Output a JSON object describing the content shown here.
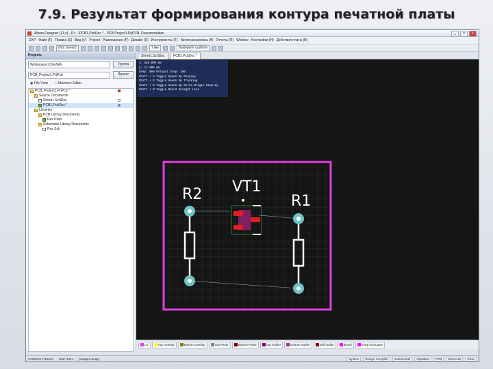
{
  "slide": {
    "title": "7.9. Результат формирования контура печатной платы"
  },
  "window": {
    "title": "Altium Designer (13.x) - D:\\...\\PCB1.PcbDoc * - PCB Project1.PrjPCB. Documentation",
    "controls": [
      "_",
      "□",
      "×"
    ]
  },
  "menu": [
    "DXP",
    "Файл (F)",
    "Правка (E)",
    "Вид (V)",
    "Project",
    "Размещение (P)",
    "Дизайн (D)",
    "Инструменты (T)",
    "Автотрассировка (A)",
    "Отчеты (R)",
    "Window",
    "Настройки (H)",
    "Действия платы (B)"
  ],
  "toolbar": {
    "combo1": "(Not Saved)",
    "combo2": "1 мм",
    "combo3": "Выберите шаблон"
  },
  "projects": {
    "header": "Projects",
    "workspace": "Workspace1.DsnWrk",
    "workspace_btn": "Группа",
    "project": "PCB_Project1.PrjPcb",
    "project_btn": "Проект",
    "view_file": "File View",
    "view_struct": "Structure Editor",
    "tree": [
      {
        "label": "PCB_Project1.PrjPcb *",
        "level": 0,
        "flag": "red"
      },
      {
        "label": "Source Documents",
        "level": 1,
        "flag": ""
      },
      {
        "label": "Sheet1.SchDoc",
        "level": 2,
        "flag": ""
      },
      {
        "label": "PCB1.PcbDoc *",
        "level": 2,
        "flag": "blue",
        "selected": true
      },
      {
        "label": "Libraries",
        "level": 1,
        "flag": ""
      },
      {
        "label": "PCB Library Documents",
        "level": 2,
        "flag": ""
      },
      {
        "label": "Res Pads",
        "level": 3,
        "flag": ""
      },
      {
        "label": "Schematic Library Documents",
        "level": 2,
        "flag": ""
      },
      {
        "label": "Res Sch",
        "level": 3,
        "flag": ""
      }
    ]
  },
  "doc_tabs": [
    "Sheet1.SchDoc",
    "PCB1.PcbDoc *"
  ],
  "hud": {
    "x": "x: 360.000 mm",
    "y": "y: 12.000 mm",
    "lines": [
      "Snap: 5mm Hotspot Snap: 1mm",
      "Shift + H  Toggle Heads Up Display",
      "Shift + G  Toggle Heads Up Tracking",
      "Shift + D  Toggle Heads Up Delta Origin Display",
      "Shift + M  Toggle Board Insight Lens"
    ]
  },
  "pcb": {
    "labels": {
      "r2": "R2",
      "vt1": "VT1",
      "r1": "R1"
    },
    "colors": {
      "board_outline": "#e040e0",
      "grid": "#3a3a3a",
      "grid_major": "#5a5a5a",
      "silk": "#ffffff",
      "pad": "#6fc3c3",
      "pad_hole": "#ffffff",
      "smd_pad": "#e02020",
      "smd_body": "#802060",
      "ratsnest": "#9aa"
    }
  },
  "layers": [
    {
      "name": "Top Overlay",
      "color": "#ffff00"
    },
    {
      "name": "Bottom Overlay",
      "color": "#808000"
    },
    {
      "name": "Top Paste",
      "color": "#808080"
    },
    {
      "name": "Bottom Paste",
      "color": "#800000"
    },
    {
      "name": "Top Solder",
      "color": "#800080"
    },
    {
      "name": "Bottom Solder",
      "color": "#aa3399"
    },
    {
      "name": "Drill Guide",
      "color": "#800000"
    },
    {
      "name": "Board",
      "color": "#ff00ff"
    },
    {
      "name": "Keep-Out Layer",
      "color": "#ff00ff"
    }
  ],
  "layerbar_active": "LS",
  "status": {
    "coords": "X:360mm Y:12mm",
    "grid": "Grid: 1mm",
    "snap": "(Hotspot Snap)",
    "right": [
      "System",
      "Design Compiler",
      "Instruments",
      "OpenBus",
      "PCB",
      "Shortcuts",
      "Clear"
    ]
  }
}
